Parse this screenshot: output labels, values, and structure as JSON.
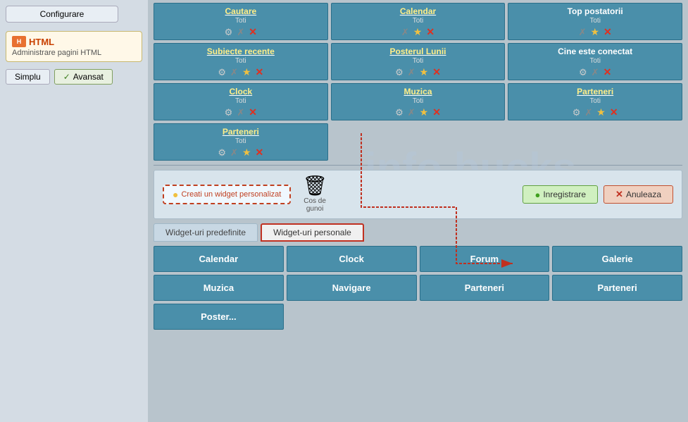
{
  "sidebar": {
    "configure_label": "Configurare",
    "html_title": "HTML",
    "html_subtitle": "Administrare pagini HTML",
    "btn_simplu": "Simplu",
    "btn_avansat": "Avansat"
  },
  "top_widgets": [
    {
      "title": "Cautare",
      "subtitle": "Toti",
      "has_link": true
    },
    {
      "title": "Calendar",
      "subtitle": "Toti",
      "has_link": true
    },
    {
      "title": "Top postatorii",
      "subtitle": "Toti",
      "has_link": false
    },
    {
      "title": "Subiecte recente",
      "subtitle": "Toti",
      "has_link": true
    },
    {
      "title": "Posterul Lunii",
      "subtitle": "Toti",
      "has_link": true
    },
    {
      "title": "Cine este conectat",
      "subtitle": "Toti",
      "has_link": false
    },
    {
      "title": "Clock",
      "subtitle": "Toti",
      "has_link": true
    },
    {
      "title": "Muzica",
      "subtitle": "Toti",
      "has_link": true
    },
    {
      "title": "Parteneri",
      "subtitle": "Toti",
      "has_link": true
    }
  ],
  "single_widget": {
    "title": "Parteneri",
    "subtitle": "Toti",
    "has_link": true
  },
  "watermark": "info.bucks",
  "create_widget_btn": "Creati un widget personalizat",
  "trash_label": "Cos de\ngunoi",
  "btn_inregistrare": "Inregistrare",
  "btn_anuleaza": "Anuleaza",
  "tabs": [
    {
      "label": "Widget-uri predefinite",
      "active": false
    },
    {
      "label": "Widget-uri personale",
      "active": true
    }
  ],
  "bottom_row1": [
    "Calendar",
    "Clock",
    "Forum",
    "Galerie"
  ],
  "bottom_row2": [
    "Muzica",
    "Navigare",
    "Parteneri",
    "Parteneri"
  ],
  "bottom_row3": [
    "Poster..."
  ]
}
